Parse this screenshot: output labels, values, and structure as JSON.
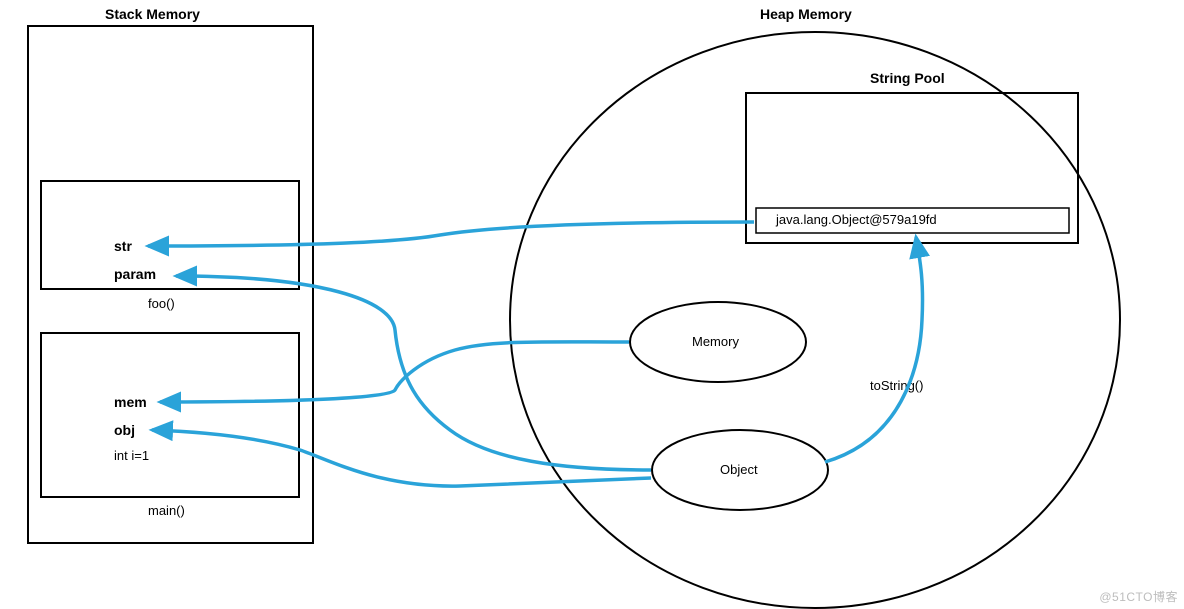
{
  "titles": {
    "stack": "Stack Memory",
    "heap": "Heap Memory",
    "stringPool": "String Pool"
  },
  "stack": {
    "foo": {
      "name": "foo()",
      "vars": {
        "str": "str",
        "param": "param"
      }
    },
    "main": {
      "name": "main()",
      "vars": {
        "mem": "mem",
        "obj": "obj",
        "intI": "int i=1"
      }
    }
  },
  "heap": {
    "stringPoolValue": "java.lang.Object@579a19fd",
    "memoryObj": "Memory",
    "objectObj": "Object",
    "toStringLabel": "toString()"
  },
  "colors": {
    "arrow": "#2aa3d9"
  },
  "watermark": "@51CTO博客"
}
